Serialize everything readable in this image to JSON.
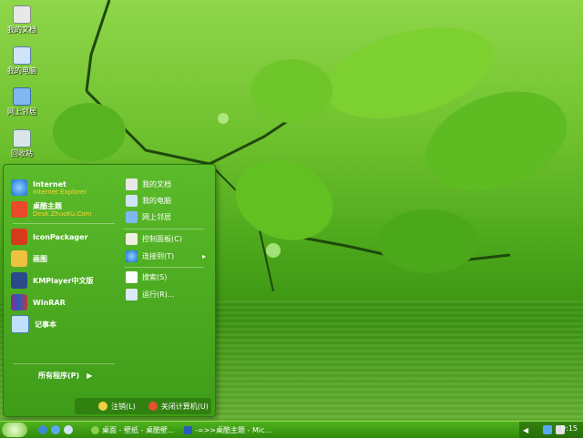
{
  "desktop": {
    "icons": [
      {
        "label": "我的文档",
        "icon": "my-documents-icon"
      },
      {
        "label": "我的电脑",
        "icon": "my-computer-icon"
      },
      {
        "label": "网上邻居",
        "icon": "network-icon"
      },
      {
        "label": "回收站",
        "icon": "recycle-bin-icon"
      }
    ]
  },
  "start_menu": {
    "pinned": [
      {
        "title": "Internet",
        "subtitle": "Internet Explorer",
        "icon": "ie-icon"
      },
      {
        "title": "桌酷主题",
        "subtitle": "Desk.ZhuoKu.Com",
        "icon": "theme-icon"
      }
    ],
    "recent": [
      {
        "title": "IconPackager",
        "icon": "iconpackager-icon"
      },
      {
        "title": "画图",
        "icon": "paint-icon"
      },
      {
        "title": "KMPlayer中文版",
        "icon": "kmplayer-icon"
      },
      {
        "title": "WinRAR",
        "icon": "winrar-icon"
      },
      {
        "title": "记事本",
        "icon": "notepad-icon"
      }
    ],
    "all_programs": "所有程序(P)",
    "right": [
      {
        "title": "我的文档",
        "icon": "documents-icon"
      },
      {
        "title": "我的电脑",
        "icon": "computer-icon"
      },
      {
        "title": "网上邻居",
        "icon": "network-icon"
      },
      {
        "title": "控制面板(C)",
        "icon": "control-panel-icon"
      },
      {
        "title": "连接到(T)",
        "icon": "connect-icon",
        "arrow": "▸"
      },
      {
        "title": "搜索(S)",
        "icon": "search-icon"
      },
      {
        "title": "运行(R)...",
        "icon": "run-icon"
      }
    ],
    "logoff": "注销(L)",
    "shutdown": "关闭计算机(U)"
  },
  "taskbar": {
    "tasks": [
      {
        "label": "桌面 - 壁纸 - 桌酷壁...",
        "icon": "browser-icon"
      },
      {
        "label": "-=>>桌酷主题 - Mic...",
        "icon": "word-icon"
      }
    ],
    "clock": "9:15"
  },
  "colors": {
    "taskbar": "#3a9a12",
    "menu": "#4eaa22",
    "subtitle": "#ffd23a"
  }
}
